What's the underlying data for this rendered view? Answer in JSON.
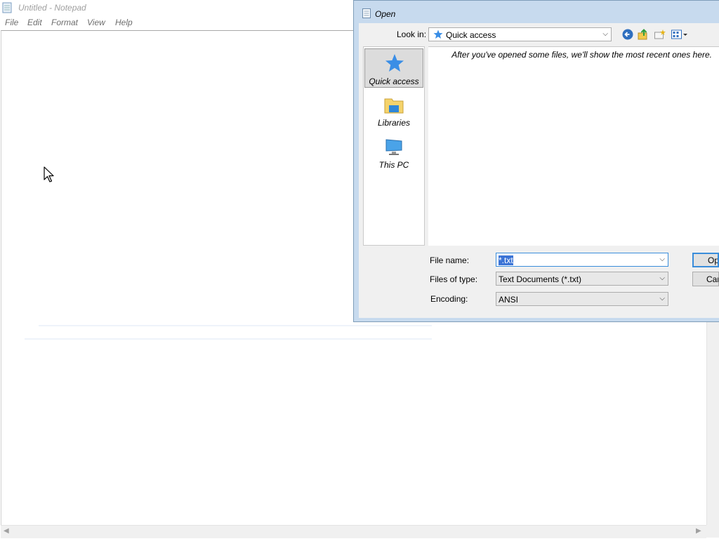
{
  "notepad": {
    "title": "Untitled - Notepad",
    "menu": [
      "File",
      "Edit",
      "Format",
      "View",
      "Help"
    ]
  },
  "dialog": {
    "title": "Open",
    "look_in_label": "Look in:",
    "look_in_value": "Quick access",
    "places": [
      "Quick access",
      "Libraries",
      "This PC"
    ],
    "empty_message": "After you've opened some files, we'll show the most recent ones here.",
    "file_name_label": "File name:",
    "file_name_value": "*.txt",
    "files_of_type_label": "Files of type:",
    "files_of_type_value": "Text Documents (*.txt)",
    "encoding_label": "Encoding:",
    "encoding_value": "ANSI",
    "open_button": "Open",
    "cancel_button": "Cancel"
  },
  "icons": {
    "quick_access": "star-icon",
    "libraries": "folder-icon",
    "this_pc": "computer-icon",
    "back": "back-arrow-icon",
    "up": "up-folder-icon",
    "new_folder": "new-folder-icon",
    "view_menu": "view-menu-icon"
  },
  "colors": {
    "selection": "#3b74d6",
    "dialog_frame": "#c7daee",
    "star": "#3a8ee6"
  }
}
